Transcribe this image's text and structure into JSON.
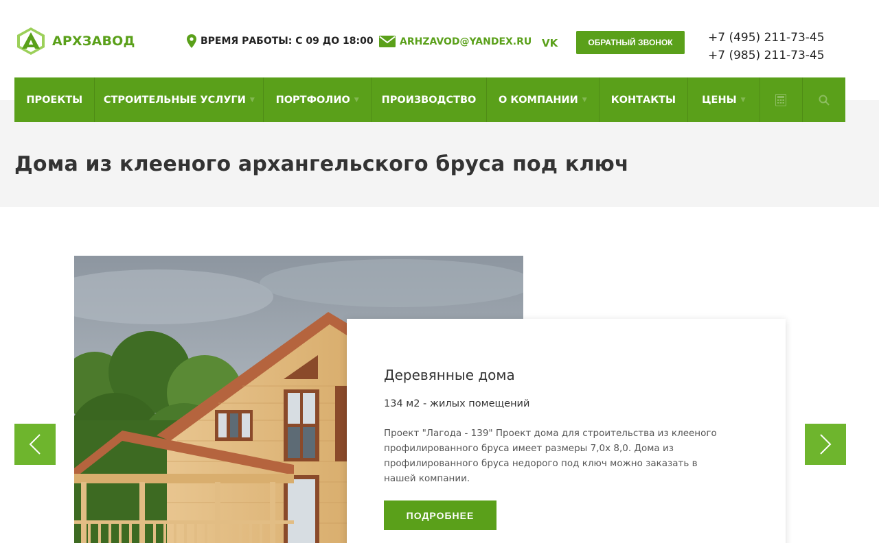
{
  "header": {
    "logo_text": "АРХЗАВОД",
    "hours": "ВРЕМЯ РАБОТЫ: С 09 ДО 18:00",
    "email": "ARHZAVOD@YANDEX.RU",
    "vk_label": "VK",
    "callback_label": "ОБРАТНЫЙ ЗВОНОК",
    "phones": [
      "+7 (495) 211-73-45",
      "+7 (985) 211-73-45"
    ]
  },
  "nav": {
    "items": [
      {
        "label": "ПРОЕКТЫ",
        "has_dropdown": false
      },
      {
        "label": "СТРОИТЕЛЬНЫЕ УСЛУГИ",
        "has_dropdown": true
      },
      {
        "label": "ПОРТФОЛИО",
        "has_dropdown": true
      },
      {
        "label": "ПРОИЗВОДСТВО",
        "has_dropdown": false
      },
      {
        "label": "О КОМПАНИИ",
        "has_dropdown": true
      },
      {
        "label": "КОНТАКТЫ",
        "has_dropdown": false
      },
      {
        "label": "ЦЕНЫ",
        "has_dropdown": true
      }
    ],
    "icons": [
      "calculator-icon",
      "search-icon"
    ]
  },
  "page": {
    "title": "Дома из клееного архангельского бруса под ключ"
  },
  "slide": {
    "title": "Деревянные дома",
    "subtitle": "134 м2 - жилых помещений",
    "description": "Проект \"Лагода - 139\" Проект дома для строительства из клееного профилированного бруса имеет размеры 7,0х 8,0. Дома из профилированного бруса недорого под ключ можно заказать в нашей компании.",
    "button_label": "ПОДРОБНЕЕ"
  },
  "colors": {
    "brand_green": "#5aa01a",
    "arrow_green": "#6eb52d",
    "band_grey": "#f4f4f4"
  }
}
